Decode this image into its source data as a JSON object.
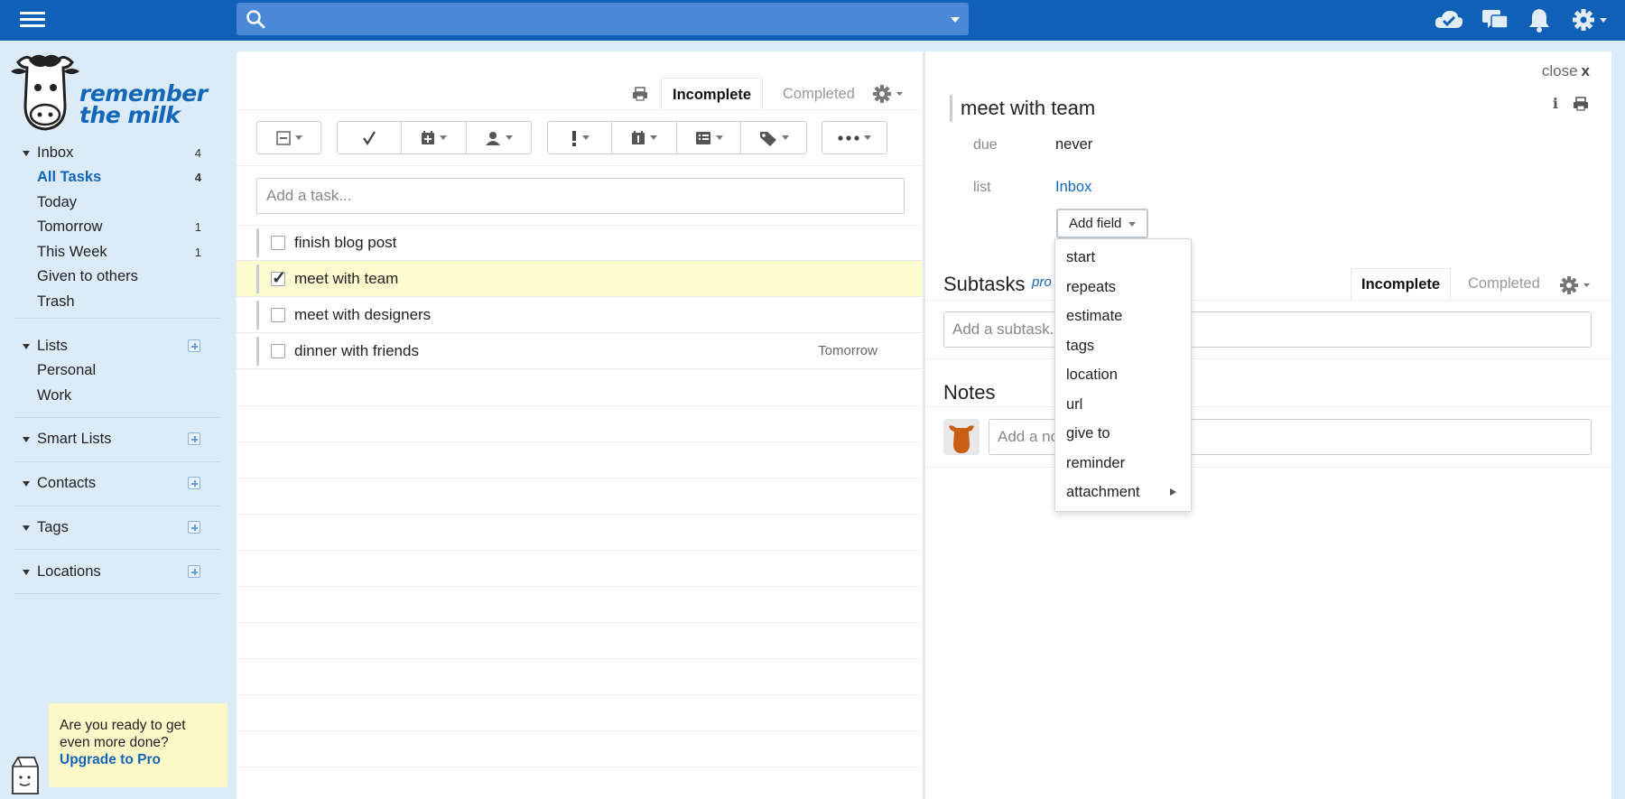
{
  "topbar": {
    "search_placeholder": "",
    "icons": [
      "menu-icon",
      "search-icon",
      "cloud-sync-icon",
      "chat-icon",
      "bell-icon",
      "gear-icon"
    ]
  },
  "brand": {
    "line1": "remember",
    "line2": "the milk"
  },
  "sidebar": {
    "inbox": {
      "label": "Inbox",
      "count": "4"
    },
    "inbox_items": [
      {
        "label": "All Tasks",
        "count": "4",
        "active": true
      },
      {
        "label": "Today",
        "count": ""
      },
      {
        "label": "Tomorrow",
        "count": "1"
      },
      {
        "label": "This Week",
        "count": "1"
      },
      {
        "label": "Given to others",
        "count": ""
      },
      {
        "label": "Trash",
        "count": ""
      }
    ],
    "lists": {
      "label": "Lists",
      "items": [
        "Personal",
        "Work"
      ]
    },
    "smart_lists": "Smart Lists",
    "contacts": "Contacts",
    "tags": "Tags",
    "locations": "Locations",
    "promo": {
      "line1": "Are you ready to get",
      "line2": "even more done?",
      "link": "Upgrade to Pro"
    }
  },
  "center": {
    "tabs": {
      "incomplete": "Incomplete",
      "completed": "Completed"
    },
    "add_task_placeholder": "Add a task...",
    "tasks": [
      {
        "name": "finish blog post",
        "due": "",
        "checked": false,
        "selected": false
      },
      {
        "name": "meet with team",
        "due": "",
        "checked": true,
        "selected": true
      },
      {
        "name": "meet with designers",
        "due": "",
        "checked": false,
        "selected": false
      },
      {
        "name": "dinner with friends",
        "due": "Tomorrow",
        "checked": false,
        "selected": false
      }
    ]
  },
  "detail": {
    "close_label": "close",
    "close_x": "x",
    "title": "meet with team",
    "info_glyph": "i",
    "due_label": "due",
    "due_value": "never",
    "list_label": "list",
    "list_value": "Inbox",
    "add_field": "Add field",
    "subtasks_title": "Subtasks",
    "pro_badge": "pro",
    "subtask_tabs": {
      "incomplete": "Incomplete",
      "completed": "Completed"
    },
    "subtask_placeholder": "Add a subtask...",
    "notes_title": "Notes",
    "note_placeholder": "Add a note..."
  },
  "dropdown": {
    "items": [
      "start",
      "repeats",
      "estimate",
      "tags",
      "location",
      "url",
      "give to",
      "reminder",
      "attachment"
    ]
  },
  "colors": {
    "topbar": "#0f60b6",
    "search": "#4b89d6",
    "sidebar": "#dcebf8",
    "accent": "#1366b8",
    "selected_row": "#fdfbd0",
    "promo": "#fdf8c8"
  }
}
